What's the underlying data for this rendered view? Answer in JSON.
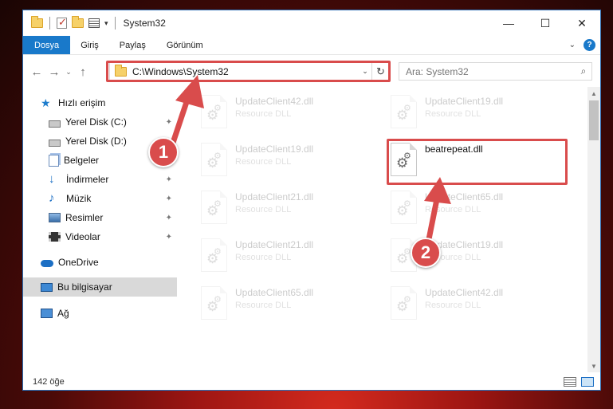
{
  "window": {
    "title": "System32",
    "controls": [
      "—",
      "☐",
      "✕"
    ]
  },
  "ribbon": {
    "tabs": [
      {
        "label": "Dosya",
        "active": true
      },
      {
        "label": "Giriş"
      },
      {
        "label": "Paylaş"
      },
      {
        "label": "Görünüm"
      }
    ],
    "help": "?",
    "expand": "⌄"
  },
  "nav": {
    "back": "←",
    "forward": "→",
    "recent": "⌄",
    "up": "↑",
    "address": "C:\\Windows\\System32",
    "address_dropdown": "⌄",
    "refresh": "↻",
    "search_placeholder": "Ara: System32",
    "search_icon": "⌕"
  },
  "sidebar": {
    "items": [
      {
        "label": "Hızlı erişim",
        "icon": "star-icon",
        "pinned": false
      },
      {
        "label": "Yerel Disk (C:)",
        "icon": "drive-icon",
        "pinned": true
      },
      {
        "label": "Yerel Disk (D:)",
        "icon": "drive-icon",
        "pinned": true
      },
      {
        "label": "Belgeler",
        "icon": "documents-icon",
        "pinned": true
      },
      {
        "label": "İndirmeler",
        "icon": "downloads-icon",
        "pinned": true
      },
      {
        "label": "Müzik",
        "icon": "music-icon",
        "pinned": true
      },
      {
        "label": "Resimler",
        "icon": "pictures-icon",
        "pinned": true
      },
      {
        "label": "Videolar",
        "icon": "videos-icon",
        "pinned": true
      },
      {
        "label": "OneDrive",
        "icon": "onedrive-icon",
        "pinned": false
      },
      {
        "label": "Bu bilgisayar",
        "icon": "this-pc-icon",
        "pinned": false,
        "selected": true
      },
      {
        "label": "Ağ",
        "icon": "network-icon",
        "pinned": false
      }
    ],
    "pin_glyph": "📌"
  },
  "files": [
    {
      "name": "UpdateClient42.dll",
      "type": "Resource DLL",
      "faded": true
    },
    {
      "name": "UpdateClient19.dll",
      "type": "Resource DLL",
      "faded": true
    },
    {
      "name": "UpdateClient19.dll",
      "type": "Resource DLL",
      "faded": true
    },
    {
      "name": "beatrepeat.dll",
      "type": "",
      "faded": false
    },
    {
      "name": "UpdateClient21.dll",
      "type": "Resource DLL",
      "faded": true
    },
    {
      "name": "UpdateClient65.dll",
      "type": "Resource DLL",
      "faded": true
    },
    {
      "name": "UpdateClient21.dll",
      "type": "Resource DLL",
      "faded": true
    },
    {
      "name": "UpdateClient19.dll",
      "type": "Resource DLL",
      "faded": true
    },
    {
      "name": "UpdateClient65.dll",
      "type": "Resource DLL",
      "faded": true
    },
    {
      "name": "UpdateClient42.dll",
      "type": "Resource DLL",
      "faded": true
    }
  ],
  "status": {
    "count": "142 öğe"
  },
  "annotations": {
    "step1": "1",
    "step2": "2",
    "color": "#d94c4c"
  }
}
